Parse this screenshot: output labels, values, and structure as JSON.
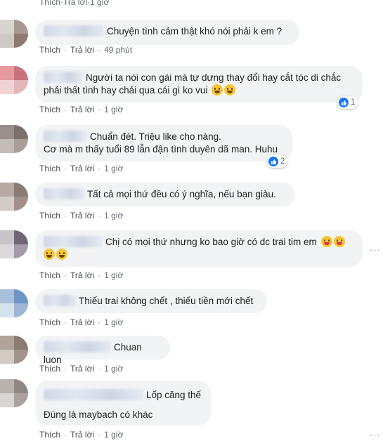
{
  "labels": {
    "like": "Thích",
    "reply": "Trả lời",
    "sep": "·"
  },
  "top_time": "1 giờ",
  "comments": [
    {
      "text": "Chuyện tình cảm thật khó nói phải k em ?",
      "time": "49 phút"
    },
    {
      "text1": "Người ta nói con gái mà tự dưng thay đổi hay cắt tóc di chắc",
      "text2": "phải thất tình hay chải qua cái gì ko vui",
      "time": "1 giờ",
      "reactions": "1"
    },
    {
      "text1": "Chuẩn đét. Triệu like cho nàng.",
      "text2": "Cơ mà m thấy tuổi 89 lẫn đận tình duyên dã man. Huhu",
      "time": "1 giờ",
      "reactions": "2"
    },
    {
      "text": "Tất cả mọi thứ đều có ý nghĩa, nếu bạn giàu.",
      "time": "1 giờ"
    },
    {
      "text": "Chị có mọi thứ nhưng ko bao giờ có dc trai tim em",
      "time": "1 giờ"
    },
    {
      "text": "Thiếu trai không chết , thiếu tiền mới chết",
      "time": "1 giờ"
    },
    {
      "text": "Chuan luon",
      "time": "1 giờ"
    },
    {
      "text1": "Lốp căng thế",
      "text2": "Đúng là maybach có khác",
      "time": "1 giờ"
    }
  ],
  "colors": {
    "like_blue": "#1877f2",
    "bubble": "#f2f3f5",
    "meta_gray": "#606770"
  }
}
